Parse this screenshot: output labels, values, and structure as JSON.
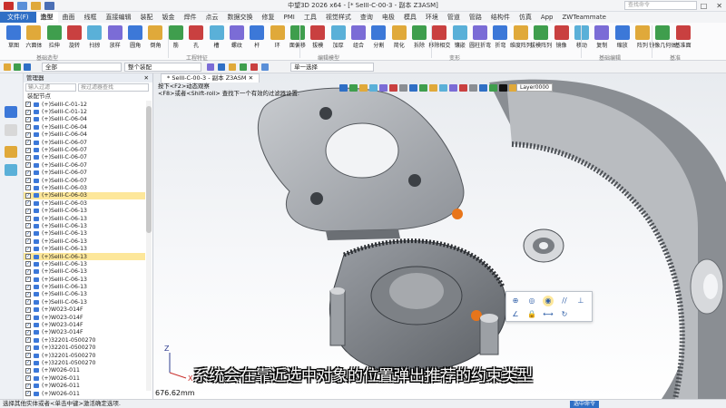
{
  "window": {
    "title": "中望3D 2026 x64 - [* SeIII-C-00-3 - 副本 Z3ASM]"
  },
  "menu": {
    "file": "文件(F)",
    "items": [
      "造型",
      "曲面",
      "线框",
      "直接编辑",
      "装配",
      "钣金",
      "焊件",
      "点云",
      "数据交换",
      "修复",
      "PMI",
      "工具",
      "视觉样式",
      "查询",
      "电极",
      "模具",
      "环境",
      "管道",
      "管路",
      "结构件",
      "仿真",
      "App",
      "ZWTeammate"
    ],
    "search_placeholder": "查找命令"
  },
  "ribbon": {
    "buttons": [
      "草图",
      "六面体",
      "拉伸",
      "旋转",
      "扫掠",
      "放样",
      "圆角",
      "倒角",
      "筋",
      "孔",
      "槽",
      "螺纹",
      "杆",
      "环",
      "面偏移",
      "拔模",
      "加厚",
      "组合",
      "分割",
      "简化",
      "拆除",
      "移除相交",
      "镶嵌",
      "圆柱折弯",
      "折弯",
      "维度阵列",
      "拔模阵列",
      "镜像",
      "移动",
      "复制",
      "缩放",
      "阵列",
      "镜像几何体",
      "基准面"
    ],
    "groups": [
      "基础造型",
      "工程特征",
      "编辑模型",
      "变形",
      "基础编辑",
      "基准"
    ]
  },
  "toolbar2": {
    "filter_all": "全部",
    "whole_assembly": "整个装配",
    "select_mode": "单一选择"
  },
  "panel": {
    "title": "管理器",
    "input_filter": "输入过滤",
    "input_search": "按过滤器查找",
    "asm_node": "装配节点",
    "items": [
      "(+)SeIII-C-01-12",
      "(+)SeIII-C-01-12",
      "(+)SeIII-C-06-04",
      "(+)SeIII-C-06-04",
      "(+)SeIII-C-06-04",
      "(+)SeIII-C-06-07",
      "(+)SeIII-C-06-07",
      "(+)SeIII-C-06-07",
      "(+)SeIII-C-06-07",
      "(+)SeIII-C-06-07",
      "(+)SeIII-C-06-07",
      "(+)SeIII-C-06-03",
      "(+)SeIII-C-06-03",
      "(+)SeIII-C-06-03",
      "(+)SeIII-C-06-13",
      "(+)SeIII-C-06-13",
      "(+)SeIII-C-06-13",
      "(+)SeIII-C-06-13",
      "(+)SeIII-C-06-13",
      "(+)SeIII-C-06-13",
      "(+)SeIII-C-06-13",
      "(+)SeIII-C-06-13",
      "(+)SeIII-C-06-13",
      "(+)SeIII-C-06-13",
      "(+)SeIII-C-06-13",
      "(+)SeIII-C-06-13",
      "(+)SeIII-C-06-13",
      "(+)W023-014F",
      "(+)W023-014F",
      "(+)W023-014F",
      "(+)W023-014F",
      "(+)32201-0500270",
      "(+)32201-0500270",
      "(+)32201-0500270",
      "(+)32201-0500270",
      "(+)W026-011",
      "(+)W026-011",
      "(+)W026-011",
      "(+)W026-011"
    ],
    "selected": [
      12,
      20
    ]
  },
  "viewport": {
    "tab": "* SeIII-C-00-3 - 副本 Z3ASM",
    "hint_line1": "按下<F2>动态观察",
    "hint_line2": "<F8>或者<Shift-roll> 查找下一个有效的过滤器设置.",
    "layer": "Layer0000",
    "measure": "676.62mm",
    "axis_z": "Z",
    "axis_x": "X"
  },
  "popup": {
    "icons": [
      "⊕",
      "◎",
      "◉",
      "//",
      "⊥",
      "∠",
      "🔒",
      "⟷",
      "↻"
    ]
  },
  "caption": "系统会在靠近选中对象的位置弹出推荐的约束类型",
  "status": {
    "text": "选择其他实体或者<单击中键>激活确定选项.",
    "button": "选中命令"
  },
  "colors": {
    "accent": "#2f6fc5",
    "selection": "#fde79a",
    "marker": "#e8751a"
  }
}
